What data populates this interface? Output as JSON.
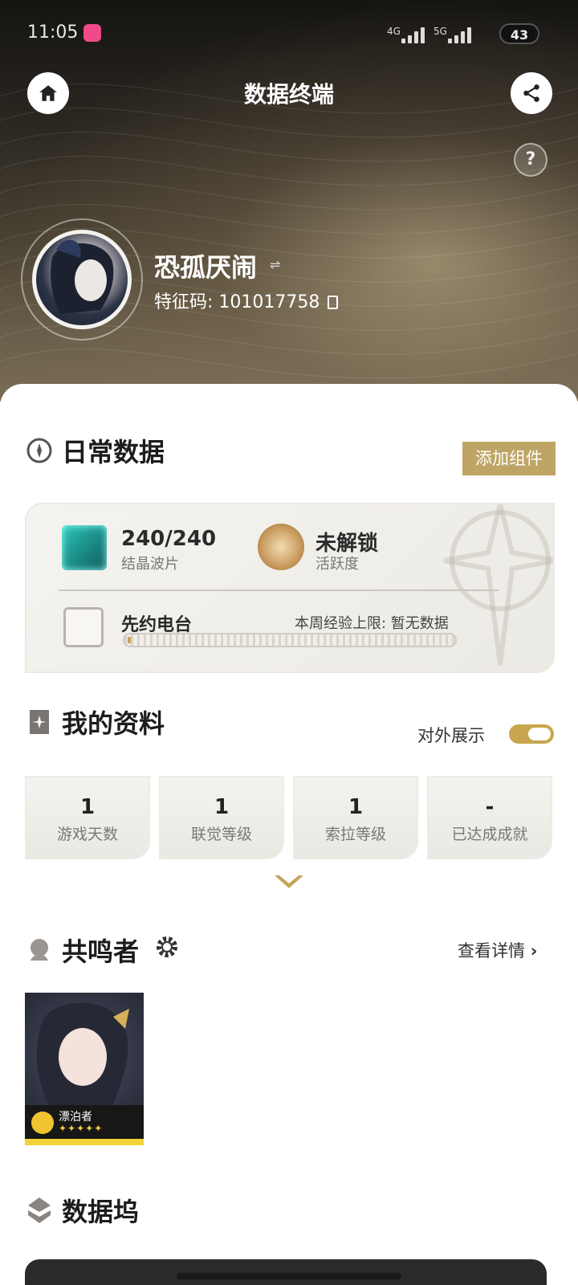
{
  "status_bar": {
    "time": "11:05",
    "net1": "4G",
    "net2": "5G",
    "battery": "43"
  },
  "header": {
    "title": "数据终端",
    "help": "?"
  },
  "profile": {
    "name": "恐孤厌闹",
    "uid_label": "特征码: 101017758"
  },
  "daily": {
    "title": "日常数据",
    "add_button": "添加组件",
    "waveplates_value": "240/240",
    "waveplates_label": "结晶波片",
    "activity_value": "未解锁",
    "activity_label": "活跃度",
    "radio_title": "先约电台",
    "radio_limit": "本周经验上限: 暂无数据",
    "radio_progress": 0
  },
  "profile_section": {
    "title": "我的资料",
    "public_label": "对外展示",
    "public_enabled": true,
    "stats": [
      {
        "value": "1",
        "label": "游戏天数"
      },
      {
        "value": "1",
        "label": "联觉等级"
      },
      {
        "value": "1",
        "label": "索拉等级"
      },
      {
        "value": "-",
        "label": "已达成成就"
      }
    ]
  },
  "resonators": {
    "title": "共鸣者",
    "detail_link": "查看详情",
    "items": [
      {
        "name": "漂泊者",
        "stars": "✦✦✦✦✦",
        "rarity": 5
      }
    ]
  },
  "databank": {
    "title": "数据坞"
  },
  "colors": {
    "accent_gold": "#bfa565",
    "toggle_gold": "#c8a64d",
    "card_bg": "#f1f0ec"
  },
  "icons": [
    "home-icon",
    "share-icon",
    "help-icon",
    "swap-icon",
    "copy-icon",
    "daily-icon",
    "crystal-icon",
    "compass-icon",
    "radio-icon",
    "card-icon",
    "resonator-icon",
    "gear-icon",
    "chevron-right-icon",
    "chevron-down-icon",
    "databank-icon"
  ]
}
